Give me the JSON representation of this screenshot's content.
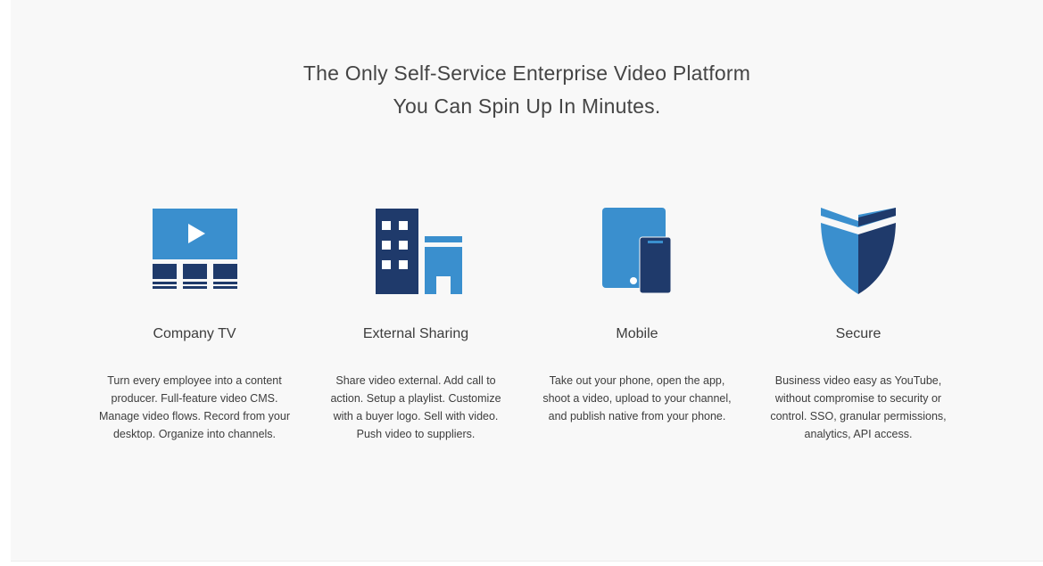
{
  "headline": {
    "line1": "The Only Self-Service Enterprise Video Platform",
    "line2": "You Can Spin Up In Minutes."
  },
  "features": [
    {
      "icon": "video-player-icon",
      "title": "Company TV",
      "description": "Turn every employee into a content producer. Full-feature video CMS. Manage video flows. Record from your desktop. Organize into channels."
    },
    {
      "icon": "buildings-icon",
      "title": "External Sharing",
      "description": "Share video external. Add call to action. Setup a playlist. Customize with a buyer logo. Sell with video. Push video to suppliers."
    },
    {
      "icon": "tablet-phone-icon",
      "title": "Mobile",
      "description": "Take out your phone, open the app, shoot a video, upload to your channel, and publish native from your phone."
    },
    {
      "icon": "shield-icon",
      "title": "Secure",
      "description": "Business video easy as YouTube, without compromise to security or control. SSO, granular permissions, analytics, API access."
    }
  ],
  "colors": {
    "primary_blue": "#3a8fce",
    "dark_navy": "#1f3a6b",
    "background": "#f8f8f8",
    "text": "#3d3d3d"
  }
}
